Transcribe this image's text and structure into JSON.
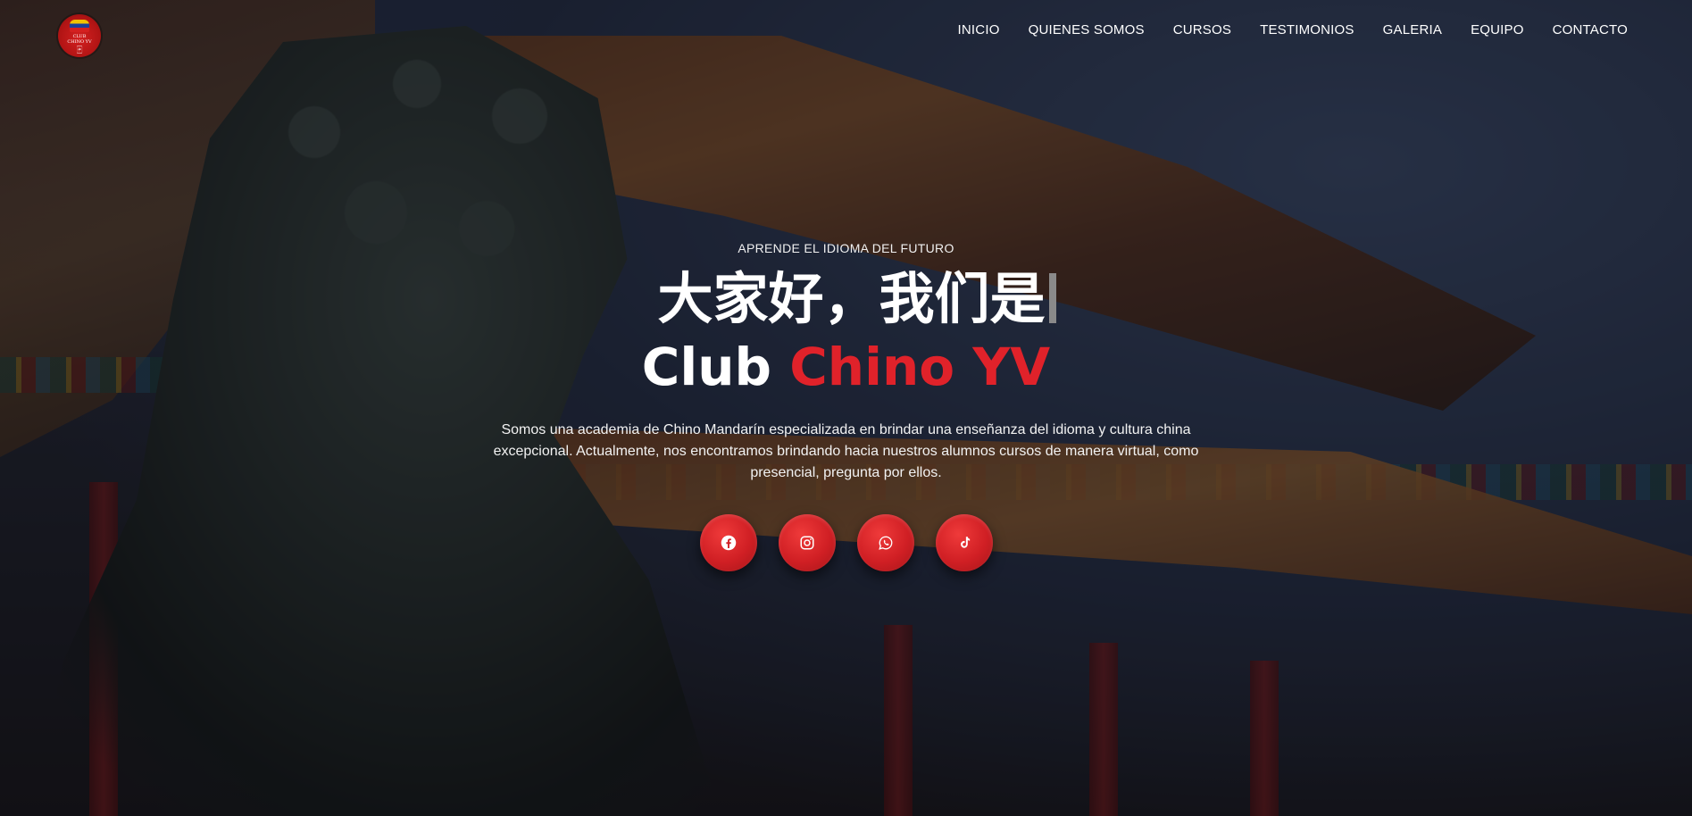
{
  "header": {
    "logo": {
      "line1": "CLUB",
      "line2": "CHINO YV",
      "glyph": "🀄︎"
    },
    "nav": [
      {
        "label": "INICIO"
      },
      {
        "label": "QUIENES SOMOS"
      },
      {
        "label": "CURSOS"
      },
      {
        "label": "TESTIMONIOS"
      },
      {
        "label": "GALERIA"
      },
      {
        "label": "EQUIPO"
      },
      {
        "label": "CONTACTO"
      }
    ]
  },
  "hero": {
    "eyebrow": "APRENDE EL IDIOMA DEL FUTURO",
    "title_cn": "大家好，我们是",
    "title_en_white": "Club ",
    "title_en_red": "Chino YV",
    "description": "Somos una academia de Chino Mandarín especializada en brindar una enseñanza del idioma y cultura china excepcional. Actualmente, nos encontramos brindando hacia nuestros alumnos cursos de manera virtual, como presencial, pregunta por ellos.",
    "socials": [
      {
        "icon": "facebook-icon"
      },
      {
        "icon": "instagram-icon"
      },
      {
        "icon": "whatsapp-icon"
      },
      {
        "icon": "tiktok-icon"
      }
    ]
  },
  "colors": {
    "accent_red": "#e0222a",
    "button_red": "#d01f24",
    "text_white": "#ffffff"
  }
}
